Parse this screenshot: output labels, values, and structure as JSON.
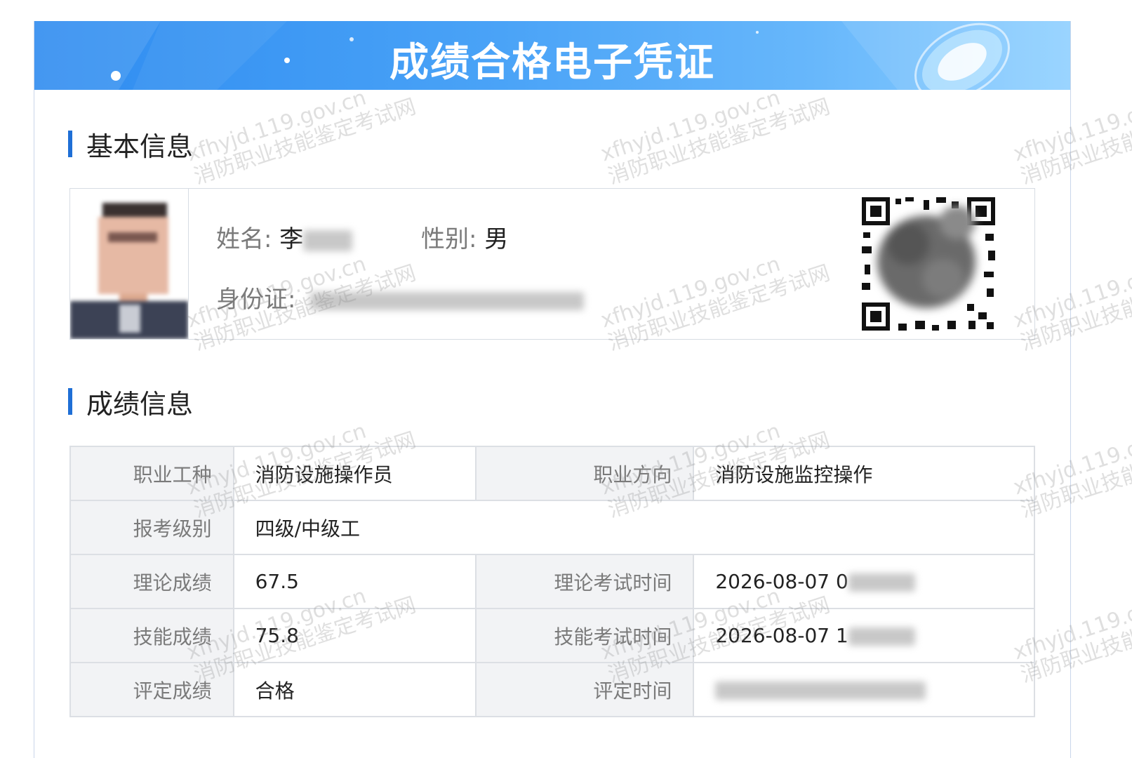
{
  "banner": {
    "title": "成绩合格电子凭证"
  },
  "watermark": {
    "line1": "xfhyjd.119.gov.cn",
    "line2": "消防职业技能鉴定考试网"
  },
  "basic": {
    "section_title": "基本信息",
    "name_label": "姓名:",
    "name_value": "李",
    "gender_label": "性别:",
    "gender_value": "男",
    "id_label": "身份证:"
  },
  "scores": {
    "section_title": "成绩信息",
    "rows": [
      {
        "l1": "职业工种",
        "v1": "消防设施操作员",
        "l2": "职业方向",
        "v2": "消防设施监控操作"
      },
      {
        "l1": "报考级别",
        "v1": "四级/中级工"
      },
      {
        "l1": "理论成绩",
        "v1": "67.5",
        "l2": "理论考试时间",
        "v2": "2026-08-07 0"
      },
      {
        "l1": "技能成绩",
        "v1": "75.8",
        "l2": "技能考试时间",
        "v2": "2026-08-07 1"
      },
      {
        "l1": "评定成绩",
        "v1": "合格",
        "l2": "评定时间",
        "v2": ""
      }
    ]
  },
  "colors": {
    "accent": "#1f6fd6",
    "banner": "#3d95f3",
    "skill_score": "#2d8cf0",
    "pass": "#1e9e4a"
  }
}
